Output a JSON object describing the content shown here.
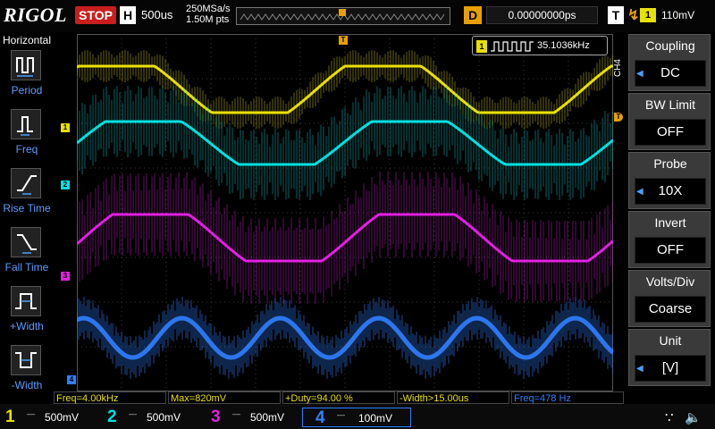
{
  "topbar": {
    "brand": "RIGOL",
    "run_state": "STOP",
    "horizontal_label": "H",
    "timebase": "500us",
    "sample_rate": "250MSa/s",
    "memory_depth": "1.50M pts",
    "delay_label": "D",
    "delay_value": "0.00000000ps",
    "trigger_label": "T",
    "trigger_edge": "rising-edge-icon",
    "trigger_source": "1",
    "trigger_level": "110mV"
  },
  "left_panel": {
    "title": "Horizontal",
    "items": [
      {
        "label": "Period",
        "icon": "period-icon"
      },
      {
        "label": "Freq",
        "icon": "freq-icon"
      },
      {
        "label": "Rise Time",
        "icon": "rise-time-icon"
      },
      {
        "label": "Fall Time",
        "icon": "fall-time-icon"
      },
      {
        "label": "+Width",
        "icon": "positive-width-icon"
      },
      {
        "label": "-Width",
        "icon": "negative-width-icon"
      }
    ]
  },
  "counter": {
    "channel": "1",
    "value": "35.1036kHz"
  },
  "right_menu": {
    "channel_tag": "CH4",
    "items": [
      {
        "title": "Coupling",
        "value": "DC"
      },
      {
        "title": "BW Limit",
        "value": "OFF"
      },
      {
        "title": "Probe",
        "value": "10X"
      },
      {
        "title": "Invert",
        "value": "OFF"
      },
      {
        "title": "Volts/Div",
        "value": "Coarse"
      },
      {
        "title": "Unit",
        "value": "[V]"
      }
    ]
  },
  "measurements": [
    {
      "text": "Freq=4.00kHz",
      "color": "#e8e000"
    },
    {
      "text": "Max=820mV",
      "color": "#e8e000"
    },
    {
      "text": "+Duty=94.00 %",
      "color": "#e8e000"
    },
    {
      "text": "-Width>15.00us",
      "color": "#e8e000"
    },
    {
      "text": "Freq=478 Hz",
      "color": "#3080ff"
    }
  ],
  "channels": [
    {
      "number": "1",
      "scale": "500mV",
      "color": "#e8e000"
    },
    {
      "number": "2",
      "scale": "500mV",
      "color": "#00e0e0"
    },
    {
      "number": "3",
      "scale": "500mV",
      "color": "#e020e0"
    },
    {
      "number": "4",
      "scale": "100mV",
      "color": "#3080ff"
    }
  ],
  "markers": {
    "ch1": "1",
    "ch2": "2",
    "ch3": "3",
    "ch4": "4",
    "trigger": "T"
  },
  "colors": {
    "ch1": "#e8e000",
    "ch2": "#00e0e0",
    "ch3": "#e020e0",
    "ch4": "#3080ff",
    "trigger": "#e8a000",
    "stop": "#c81e1e"
  }
}
